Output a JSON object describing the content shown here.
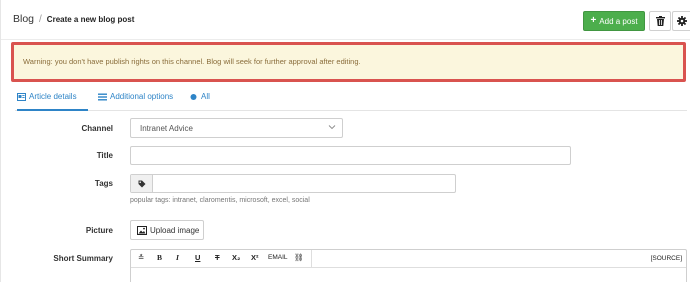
{
  "header": {
    "breadcrumb_root": "Blog",
    "breadcrumb_separator": "/",
    "breadcrumb_current": "Create a new blog post",
    "add_post_label": "Add a post",
    "add_post_icon": "plus-icon",
    "trash_icon": "trash-icon",
    "gear_icon": "gear-icon"
  },
  "warning": {
    "text": "Warning: you don't have publish rights on this channel. Blog will seek for further approval after editing."
  },
  "tabs": [
    {
      "label": "Article details",
      "icon": "card-icon",
      "active": true
    },
    {
      "label": "Additional options",
      "icon": "list-icon",
      "active": false
    },
    {
      "label": "All",
      "icon": "dot-icon",
      "active": false
    }
  ],
  "form": {
    "channel_label": "Channel",
    "channel_value": "Intranet Advice",
    "title_label": "Title",
    "title_value": "",
    "tags_label": "Tags",
    "tags_value": "",
    "tags_hint": "popular tags: intranet,  claromentis,  microsoft,  excel,  social",
    "picture_label": "Picture",
    "upload_label": "Upload image",
    "summary_label": "Short Summary"
  },
  "editor": {
    "toolbar": [
      "≛",
      "B",
      "I",
      "U",
      "T",
      "X₂",
      "X²",
      "EMAIL",
      "⛓"
    ],
    "source_label": "[SOURCE]"
  },
  "colors": {
    "accent": "#2e84c7",
    "success": "#4cae4c",
    "warning_bg": "#fbf6dd",
    "warning_border": "#d9534f",
    "warning_text": "#8a6d3b"
  }
}
